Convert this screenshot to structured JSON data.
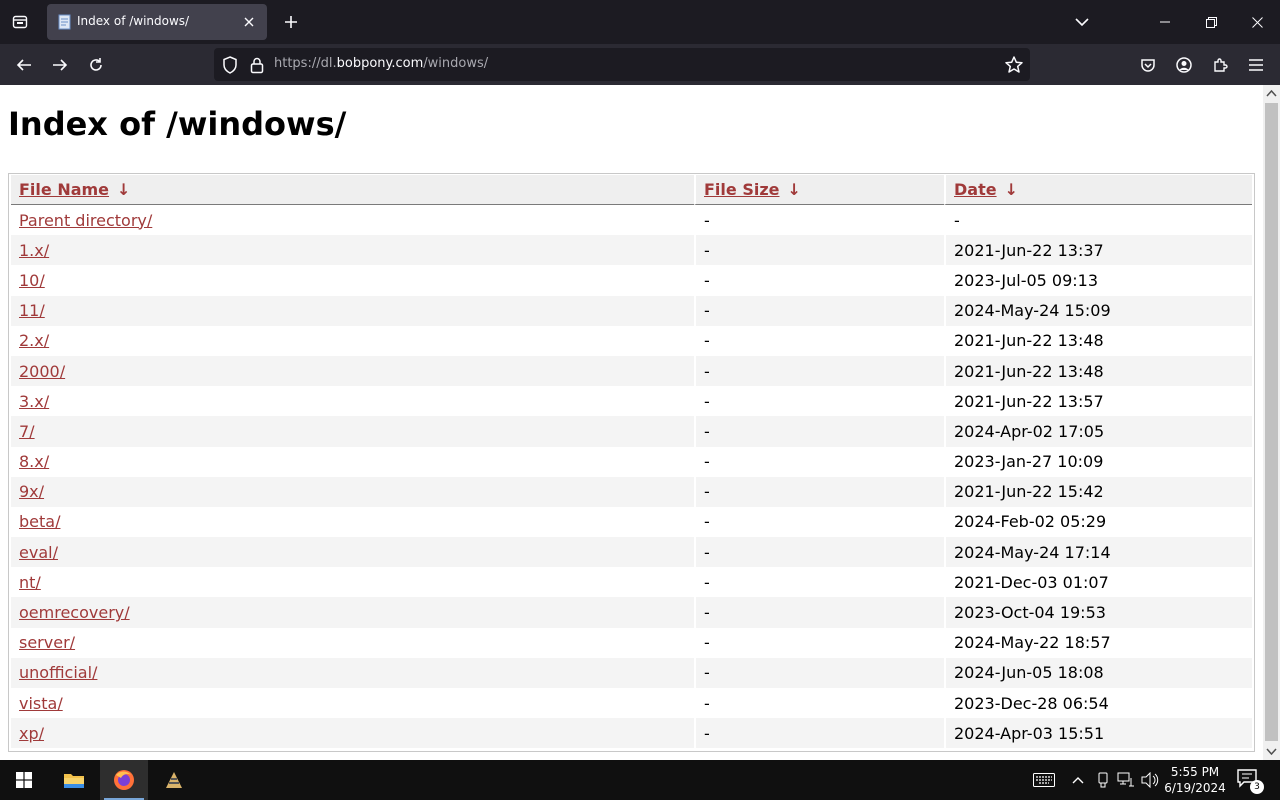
{
  "browser": {
    "tab_title": "Index of /windows/",
    "url_scheme_sub": "https://dl.",
    "url_host": "bobpony.com",
    "url_path": "/windows/"
  },
  "page": {
    "title": "Index of /windows/",
    "columns": {
      "name": "File Name",
      "size": "File Size",
      "date": "Date",
      "sort_arrow": "↓"
    },
    "rows": [
      {
        "name": "Parent directory/",
        "size": "-",
        "date": "-"
      },
      {
        "name": "1.x/",
        "size": "-",
        "date": "2021-Jun-22 13:37"
      },
      {
        "name": "10/",
        "size": "-",
        "date": "2023-Jul-05 09:13"
      },
      {
        "name": "11/",
        "size": "-",
        "date": "2024-May-24 15:09"
      },
      {
        "name": "2.x/",
        "size": "-",
        "date": "2021-Jun-22 13:48"
      },
      {
        "name": "2000/",
        "size": "-",
        "date": "2021-Jun-22 13:48"
      },
      {
        "name": "3.x/",
        "size": "-",
        "date": "2021-Jun-22 13:57"
      },
      {
        "name": "7/",
        "size": "-",
        "date": "2024-Apr-02 17:05"
      },
      {
        "name": "8.x/",
        "size": "-",
        "date": "2023-Jan-27 10:09"
      },
      {
        "name": "9x/",
        "size": "-",
        "date": "2021-Jun-22 15:42"
      },
      {
        "name": "beta/",
        "size": "-",
        "date": "2024-Feb-02 05:29"
      },
      {
        "name": "eval/",
        "size": "-",
        "date": "2024-May-24 17:14"
      },
      {
        "name": "nt/",
        "size": "-",
        "date": "2021-Dec-03 01:07"
      },
      {
        "name": "oemrecovery/",
        "size": "-",
        "date": "2023-Oct-04 19:53"
      },
      {
        "name": "server/",
        "size": "-",
        "date": "2024-May-22 18:57"
      },
      {
        "name": "unofficial/",
        "size": "-",
        "date": "2024-Jun-05 18:08"
      },
      {
        "name": "vista/",
        "size": "-",
        "date": "2023-Dec-28 06:54"
      },
      {
        "name": "xp/",
        "size": "-",
        "date": "2024-Apr-03 15:51"
      }
    ]
  },
  "taskbar": {
    "time": "5:55 PM",
    "date": "6/19/2024",
    "notification_count": "3"
  },
  "colors": {
    "link": "#a03a3a",
    "chrome_dark": "#1c1b22",
    "toolbar": "#2b2a33",
    "tab_active": "#42414d"
  }
}
